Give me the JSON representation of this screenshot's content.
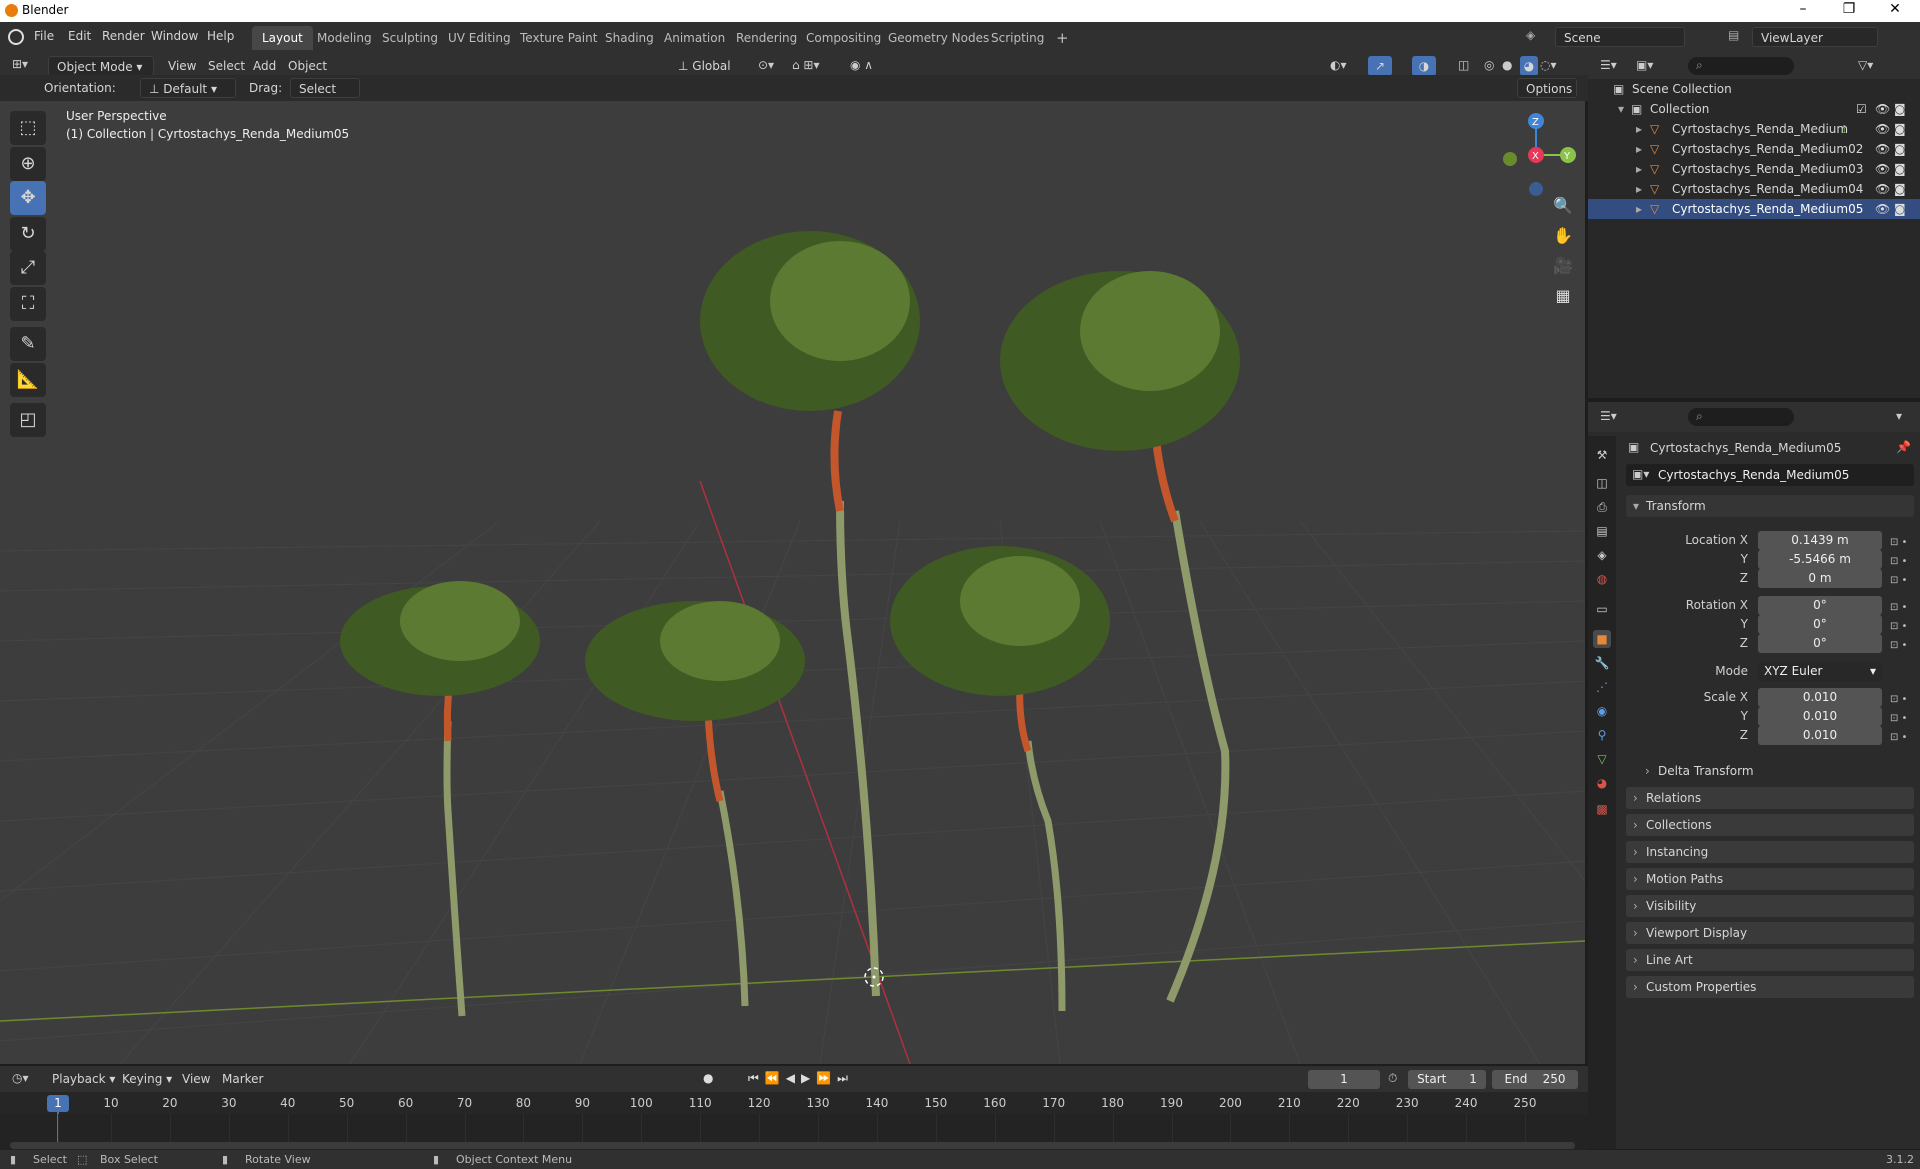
{
  "window": {
    "title": "Blender",
    "min": "–",
    "max": "❐",
    "close": "✕"
  },
  "menu": [
    "File",
    "Edit",
    "Render",
    "Window",
    "Help"
  ],
  "workspaces": [
    "Layout",
    "Modeling",
    "Sculpting",
    "UV Editing",
    "Texture Paint",
    "Shading",
    "Animation",
    "Rendering",
    "Compositing",
    "Geometry Nodes",
    "Scripting",
    "+"
  ],
  "scene": {
    "name": "Scene",
    "viewlayer": "ViewLayer"
  },
  "viewport_header": {
    "mode": "Object Mode",
    "menus": [
      "View",
      "Select",
      "Add",
      "Object"
    ],
    "transform": "Global",
    "options": "Options"
  },
  "tool_settings": {
    "orientation_label": "Orientation:",
    "orientation_value": "Default",
    "drag_label": "Drag:",
    "drag_value": "Select Box"
  },
  "overlay": {
    "line1": "User Perspective",
    "line2": "(1) Collection | Cyrtostachys_Renda_Medium05"
  },
  "gizmo": {
    "z": "Z",
    "x": "X",
    "y": "Y"
  },
  "outliner": {
    "scene_collection": "Scene Collection",
    "collection": "Collection",
    "items": [
      "Cyrtostachys_Renda_Medium",
      "Cyrtostachys_Renda_Medium02",
      "Cyrtostachys_Renda_Medium03",
      "Cyrtostachys_Renda_Medium04",
      "Cyrtostachys_Renda_Medium05"
    ]
  },
  "properties": {
    "object_name": "Cyrtostachys_Renda_Medium05",
    "data_name": "Cyrtostachys_Renda_Medium05",
    "transform_label": "Transform",
    "location": {
      "label_x": "Location X",
      "x": "0.1439 m",
      "y": "-5.5466 m",
      "z": "0 m"
    },
    "rotation": {
      "label_x": "Rotation X",
      "x": "0°",
      "y": "0°",
      "z": "0°"
    },
    "mode": {
      "label": "Mode",
      "value": "XYZ Euler"
    },
    "scale": {
      "label_x": "Scale X",
      "x": "0.010",
      "y": "0.010",
      "z": "0.010"
    },
    "axis_y": "Y",
    "axis_z": "Z",
    "delta": "Delta Transform",
    "panels": [
      "Relations",
      "Collections",
      "Instancing",
      "Motion Paths",
      "Visibility",
      "Viewport Display",
      "Line Art",
      "Custom Properties"
    ]
  },
  "timeline": {
    "menus": [
      "Playback",
      "Keying",
      "View",
      "Marker"
    ],
    "current_frame": "1",
    "start_label": "Start",
    "start": "1",
    "end_label": "End",
    "end": "250",
    "ticks": [
      "1",
      "10",
      "20",
      "30",
      "40",
      "50",
      "60",
      "70",
      "80",
      "90",
      "100",
      "110",
      "120",
      "130",
      "140",
      "150",
      "160",
      "170",
      "180",
      "190",
      "200",
      "210",
      "220",
      "230",
      "240",
      "250"
    ]
  },
  "status": {
    "select": "Select",
    "box_select": "Box Select",
    "rotate": "Rotate View",
    "context": "Object Context Menu",
    "version": "3.1.2"
  },
  "colors": {
    "accent": "#4772b3",
    "x_axis": "#e8385a",
    "y_axis": "#8bc34a",
    "z_axis": "#3f86d8",
    "object_orange": "#e8893a"
  }
}
